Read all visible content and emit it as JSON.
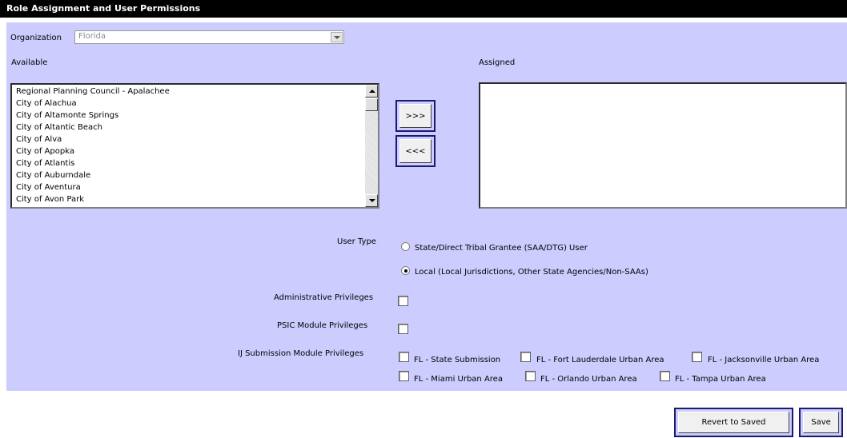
{
  "header": {
    "title": "Role Assignment and User Permissions"
  },
  "organization": {
    "label": "Organization",
    "value": "Florida"
  },
  "available": {
    "label": "Available",
    "items": [
      "Regional Planning Council - Apalachee",
      "City of Alachua",
      "City of Altamonte Springs",
      "City of Altantic Beach",
      "City of Alva",
      "City of Apopka",
      "City of Atlantis",
      "City of Auburndale",
      "City of Aventura",
      "City of Avon Park"
    ]
  },
  "assigned": {
    "label": "Assigned"
  },
  "transfer": {
    "add_label": ">>>",
    "remove_label": "<<<"
  },
  "user_type": {
    "label": "User Type",
    "options": [
      {
        "label": "State/Direct Tribal Grantee (SAA/DTG) User",
        "selected": false
      },
      {
        "label": "Local (Local Jurisdictions, Other State Agencies/Non-SAAs)",
        "selected": true
      }
    ]
  },
  "admin_privileges": {
    "label": "Administrative Privileges",
    "checked": false
  },
  "psic_privileges": {
    "label": "PSIC Module Privileges",
    "checked": false
  },
  "ij_privileges": {
    "label": "IJ Submission Module Privileges",
    "options": [
      "FL - State Submission",
      "FL - Fort Lauderdale Urban Area",
      "FL - Jacksonville Urban Area",
      "FL - Miami Urban Area",
      "FL - Orlando Urban Area",
      "FL - Tampa Urban Area"
    ]
  },
  "actions": {
    "revert_label": "Revert to Saved",
    "save_label": "Save"
  },
  "colors": {
    "panel": "#ccccff",
    "titlebar": "#000000",
    "button_frame": "#1a1a6e"
  }
}
